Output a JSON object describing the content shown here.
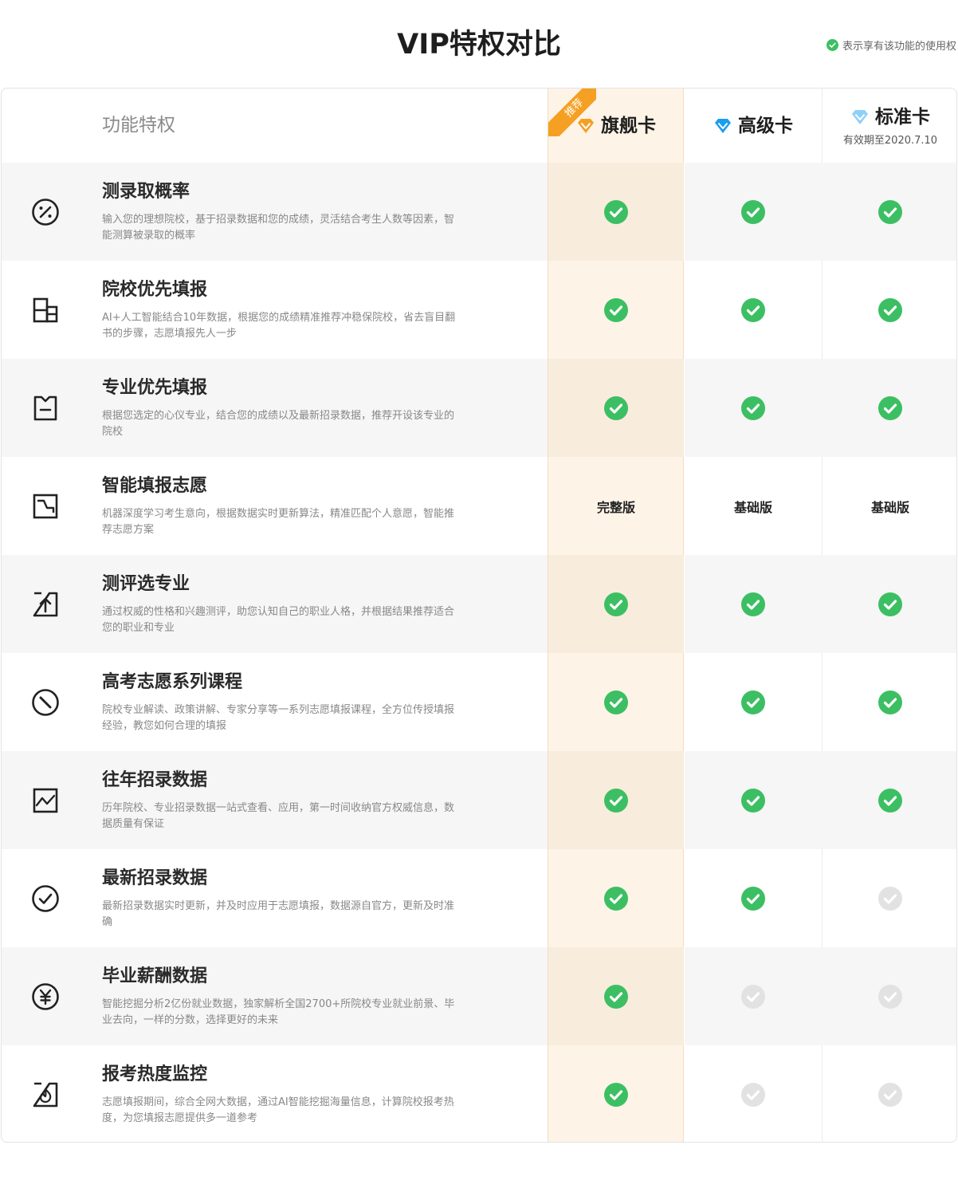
{
  "title": "VIP特权对比",
  "legend": {
    "text": "表示享有该功能的使用权",
    "icon": "check-circle-icon",
    "color": "#3cbf63"
  },
  "header": {
    "feature_label": "功能特权",
    "badge": "推荐",
    "plans": [
      {
        "name": "旗舰卡",
        "icon": "diamond-orange-icon",
        "color": "#f5a022",
        "sub": ""
      },
      {
        "name": "高级卡",
        "icon": "diamond-blue-icon",
        "color": "#1a9cf0",
        "sub": ""
      },
      {
        "name": "标准卡",
        "icon": "diamond-lightblue-icon",
        "color": "#8fd0f7",
        "sub": "有效期至2020.7.10"
      }
    ]
  },
  "colors": {
    "check": "#3cbf63",
    "disabled": "#e2e2e2",
    "flagship_bg": "#fdf3e7"
  },
  "features": [
    {
      "icon": "percent-icon",
      "title": "测录取概率",
      "desc": "输入您的理想院校，基于招录数据和您的成绩，灵活结合考生人数等因素，智能测算被录取的概率",
      "values": [
        "check",
        "check",
        "check"
      ]
    },
    {
      "icon": "building-icon",
      "title": "院校优先填报",
      "desc": "AI+人工智能结合10年数据，根据您的成绩精准推荐冲稳保院校，省去盲目翻书的步骤，志愿填报先人一步",
      "values": [
        "check",
        "check",
        "check"
      ]
    },
    {
      "icon": "bookmark-icon",
      "title": "专业优先填报",
      "desc": "根据您选定的心仪专业，结合您的成绩以及最新招录数据，推荐开设该专业的院校",
      "values": [
        "check",
        "check",
        "check"
      ]
    },
    {
      "icon": "trend-icon",
      "title": "智能填报志愿",
      "desc": "机器深度学习考生意向，根据数据实时更新算法，精准匹配个人意愿，智能推荐志愿方案",
      "values": [
        "完整版",
        "基础版",
        "基础版"
      ]
    },
    {
      "icon": "upload-icon",
      "title": "测评选专业",
      "desc": "通过权威的性格和兴趣测评，助您认知自己的职业人格，并根据结果推荐适合您的职业和专业",
      "values": [
        "check",
        "check",
        "check"
      ]
    },
    {
      "icon": "compass-icon",
      "title": "高考志愿系列课程",
      "desc": "院校专业解读、政策讲解、专家分享等一系列志愿填报课程，全方位传授填报经验，教您如何合理的填报",
      "values": [
        "check",
        "check",
        "check"
      ]
    },
    {
      "icon": "chart-icon",
      "title": "往年招录数据",
      "desc": "历年院校、专业招录数据一站式查看、应用，第一时间收纳官方权威信息，数据质量有保证",
      "values": [
        "check",
        "check",
        "check"
      ]
    },
    {
      "icon": "check-circle-outline-icon",
      "title": "最新招录数据",
      "desc": "最新招录数据实时更新，并及时应用于志愿填报，数据源自官方，更新及时准确",
      "values": [
        "check",
        "check",
        "disabled"
      ]
    },
    {
      "icon": "yen-icon",
      "title": "毕业薪酬数据",
      "desc": "智能挖掘分析2亿份就业数据，独家解析全国2700+所院校专业就业前景、毕业去向，一样的分数，选择更好的未来",
      "values": [
        "check",
        "disabled",
        "disabled"
      ]
    },
    {
      "icon": "flame-icon",
      "title": "报考热度监控",
      "desc": "志愿填报期间，综合全网大数据，通过AI智能挖掘海量信息，计算院校报考热度，为您填报志愿提供多一道参考",
      "values": [
        "check",
        "disabled",
        "disabled"
      ]
    }
  ]
}
